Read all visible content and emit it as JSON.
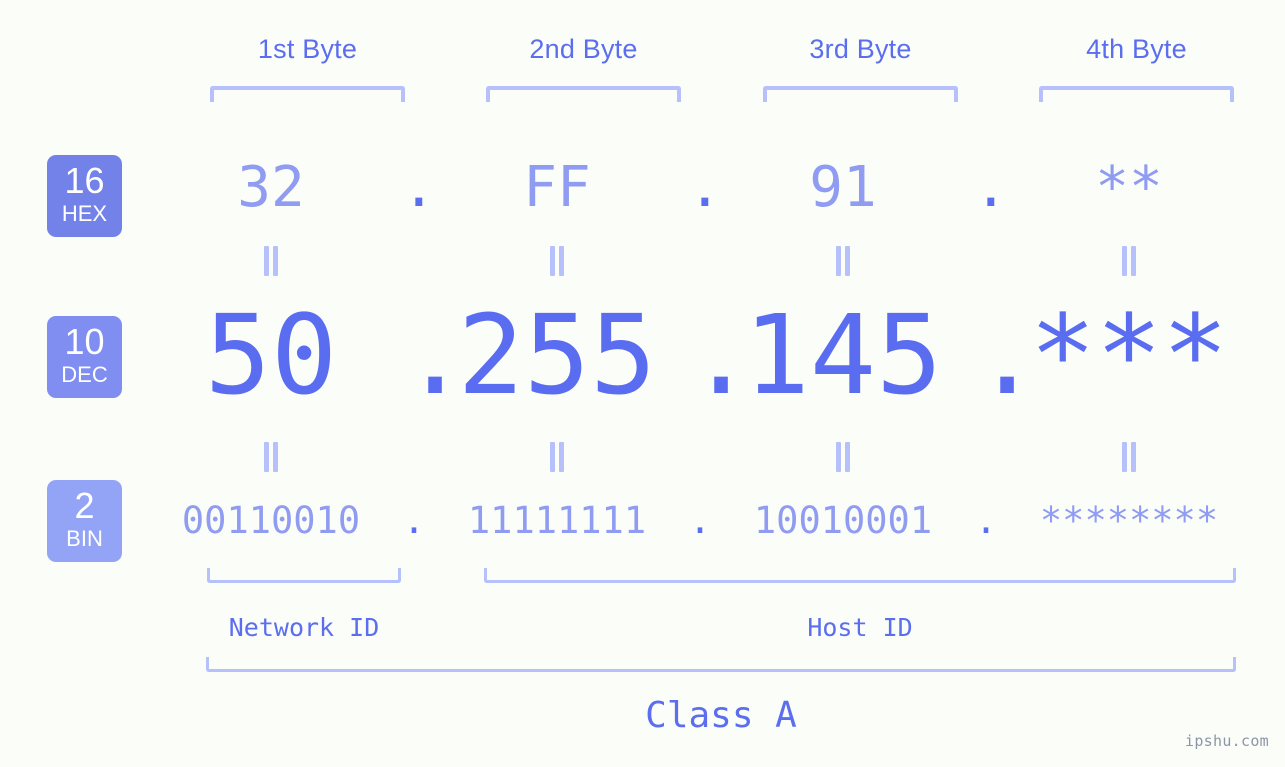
{
  "background_color": "#fbfdf8",
  "accent_color": "#5b6ef0",
  "accent_light_color": "#8f9cf2",
  "bracket_color": "#b6c0fb",
  "header": {
    "byte_labels": [
      "1st Byte",
      "2nd Byte",
      "3rd Byte",
      "4th Byte"
    ]
  },
  "radix_rows": [
    {
      "badge_number": "16",
      "badge_name": "HEX",
      "badge_color": "#7382e8",
      "values": [
        "32",
        "FF",
        "91",
        "**"
      ],
      "separator": "."
    },
    {
      "badge_number": "10",
      "badge_name": "DEC",
      "badge_color": "#7f8ef0",
      "values": [
        "50",
        "255",
        "145",
        "***"
      ],
      "separator": "."
    },
    {
      "badge_number": "2",
      "badge_name": "BIN",
      "badge_color": "#93a4f7",
      "values": [
        "00110010",
        "11111111",
        "10010001",
        "********"
      ],
      "separator": "."
    }
  ],
  "equals_marker": "=",
  "footer": {
    "network_id_label": "Network ID",
    "host_id_label": "Host ID",
    "class_label": "Class A"
  },
  "watermark": "ipshu.com"
}
